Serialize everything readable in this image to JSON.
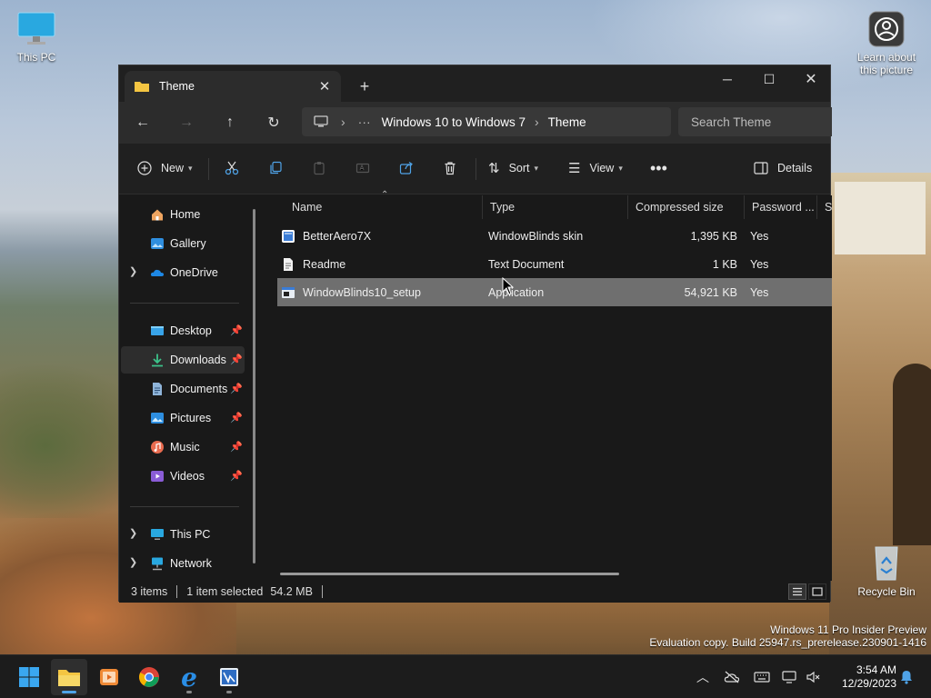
{
  "desktop": {
    "icons": {
      "this_pc": "This PC",
      "learn_picture": "Learn about this picture",
      "recycle_bin": "Recycle Bin"
    },
    "watermark": {
      "line1": "Windows 11 Pro Insider Preview",
      "line2": "Evaluation copy. Build 25947.rs_prerelease.230901-1416"
    }
  },
  "window": {
    "tab_title": "Theme",
    "new_tab_label": "+",
    "controls": [
      "minimize",
      "maximize",
      "close"
    ],
    "address": {
      "crumbs": [
        "Windows 10 to Windows 7",
        "Theme"
      ],
      "search_placeholder": "Search Theme"
    },
    "toolbar": {
      "new_label": "New",
      "sort_label": "Sort",
      "view_label": "View",
      "details_label": "Details"
    },
    "sidebar": {
      "home": "Home",
      "gallery": "Gallery",
      "onedrive": "OneDrive",
      "desktop": "Desktop",
      "downloads": "Downloads",
      "documents": "Documents",
      "pictures": "Pictures",
      "music": "Music",
      "videos": "Videos",
      "this_pc": "This PC",
      "network": "Network"
    },
    "columns": {
      "name": "Name",
      "type": "Type",
      "compressed_size": "Compressed size",
      "password": "Password ...",
      "size": "Si"
    },
    "files": [
      {
        "name": "BetterAero7X",
        "type": "WindowBlinds skin",
        "compressed": "1,395 KB",
        "password": "Yes"
      },
      {
        "name": "Readme",
        "type": "Text Document",
        "compressed": "1 KB",
        "password": "Yes"
      },
      {
        "name": "WindowBlinds10_setup",
        "type": "Application",
        "compressed": "54,921 KB",
        "password": "Yes"
      }
    ],
    "status": {
      "items": "3 items",
      "selected": "1 item selected",
      "size": "54.2 MB"
    }
  },
  "taskbar": {
    "clock": {
      "time": "3:54 AM",
      "date": "12/29/2023"
    }
  },
  "colors": {
    "accent": "#0078d4",
    "folder_yellow": "#f4c542",
    "selected_row": "#6f6f6f"
  }
}
